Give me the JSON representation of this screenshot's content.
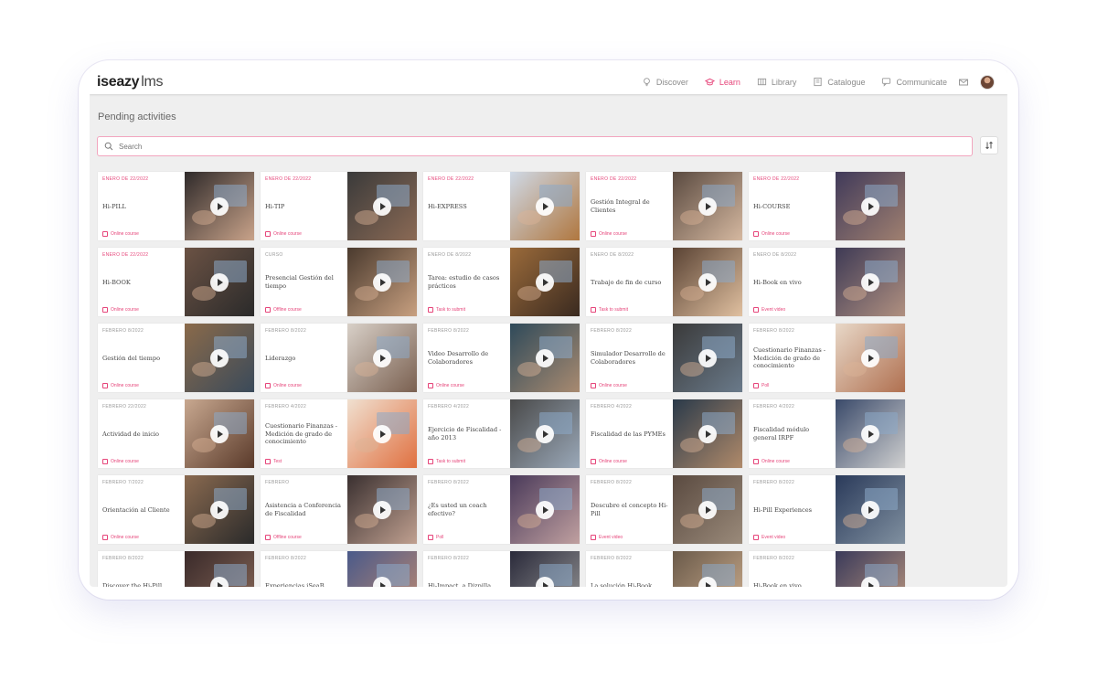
{
  "app": {
    "logo_bold": "iseazy",
    "logo_light": "lms",
    "nav": [
      {
        "label": "Discover",
        "icon": "bulb-icon",
        "active": false
      },
      {
        "label": "Learn",
        "icon": "learn-icon",
        "active": true
      },
      {
        "label": "Library",
        "icon": "library-icon",
        "active": false
      },
      {
        "label": "Catalogue",
        "icon": "catalogue-icon",
        "active": false
      },
      {
        "label": "Communicate",
        "icon": "chat-icon",
        "active": false
      }
    ],
    "accent_color": "#e6457a"
  },
  "page": {
    "title": "Pending activities",
    "search_placeholder": "Search"
  },
  "cards": [
    {
      "date": "ENERO DE 22/2022",
      "title": "Hi-PILL",
      "type": "Online course",
      "date_muted": false
    },
    {
      "date": "ENERO DE 22/2022",
      "title": "Hi-TIP",
      "type": "Online course",
      "date_muted": false
    },
    {
      "date": "ENERO DE 22/2022",
      "title": "Hi-EXPRESS",
      "type": "",
      "date_muted": false
    },
    {
      "date": "ENERO DE 22/2022",
      "title": "Gestión Integral de Clientes",
      "type": "Online course",
      "date_muted": false
    },
    {
      "date": "ENERO DE 22/2022",
      "title": "Hi-COURSE",
      "type": "Online course",
      "date_muted": false
    },
    {
      "date": "ENERO DE 22/2022",
      "title": "Hi-BOOK",
      "type": "Online course",
      "date_muted": false
    },
    {
      "date": "CURSO",
      "title": "Presencial Gestión del tiempo",
      "type": "Offline course",
      "date_muted": true
    },
    {
      "date": "ENERO DE 8/2022",
      "title": "Tarea: estudio de casos prácticos",
      "type": "Task to submit",
      "date_muted": true
    },
    {
      "date": "ENERO DE 8/2022",
      "title": "Trabajo de fin de curso",
      "type": "Task to submit",
      "date_muted": true
    },
    {
      "date": "ENERO DE 8/2022",
      "title": "Hi-Book en vivo",
      "type": "Event video",
      "date_muted": true
    },
    {
      "date": "FEBRERO 8/2022",
      "title": "Gestión del tiempo",
      "type": "Online course",
      "date_muted": true
    },
    {
      "date": "FEBRERO 8/2022",
      "title": "Liderazgo",
      "type": "Online course",
      "date_muted": true
    },
    {
      "date": "FEBRERO 8/2022",
      "title": "Video Desarrollo de Colaboradores",
      "type": "Online course",
      "date_muted": true
    },
    {
      "date": "FEBRERO 8/2022",
      "title": "Simulador Desarrollo de Colaboradores",
      "type": "Online course",
      "date_muted": true
    },
    {
      "date": "FEBRERO 8/2022",
      "title": "Cuestionario Finanzas - Medición de grado de conocimiento",
      "type": "Poll",
      "date_muted": true
    },
    {
      "date": "FEBRERO 22/2022",
      "title": "Actividad de inicio",
      "type": "Online course",
      "date_muted": true
    },
    {
      "date": "FEBRERO 4/2022",
      "title": "Cuestionario Finanzas - Medición de grado de conocimiento",
      "type": "Test",
      "date_muted": true
    },
    {
      "date": "FEBRERO 4/2022",
      "title": "Ejercicio de Fiscalidad - año 2013",
      "type": "Task to submit",
      "date_muted": true
    },
    {
      "date": "FEBRERO 4/2022",
      "title": "Fiscalidad de las PYMEs",
      "type": "Online course",
      "date_muted": true
    },
    {
      "date": "FEBRERO 4/2022",
      "title": "Fiscalidad módulo general IRPF",
      "type": "Online course",
      "date_muted": true
    },
    {
      "date": "FEBRERO 7/2022",
      "title": "Orientación al Cliente",
      "type": "Online course",
      "date_muted": true
    },
    {
      "date": "FEBRERO",
      "title": "Asistencia a Conferencia de Fiscalidad",
      "type": "Offline course",
      "date_muted": true
    },
    {
      "date": "FEBRERO 8/2022",
      "title": "¿Es usted un coach efectivo?",
      "type": "Poll",
      "date_muted": true
    },
    {
      "date": "FEBRERO 8/2022",
      "title": "Descubre el concepto Hi-Pill",
      "type": "Event video",
      "date_muted": true
    },
    {
      "date": "FEBRERO 8/2022",
      "title": "Hi-Pill Experiences",
      "type": "Event video",
      "date_muted": true
    },
    {
      "date": "FEBRERO 8/2022",
      "title": "Discover the Hi-Pill",
      "type": "",
      "date_muted": true
    },
    {
      "date": "FEBRERO 8/2022",
      "title": "Experiencias iSeaB",
      "type": "",
      "date_muted": true
    },
    {
      "date": "FEBRERO 8/2022",
      "title": "Hi-Impact, a Dizpilla",
      "type": "",
      "date_muted": true
    },
    {
      "date": "FEBRERO 8/2022",
      "title": "La solución Hi-Book",
      "type": "",
      "date_muted": true
    },
    {
      "date": "FEBRERO 8/2022",
      "title": "Hi-Book en vivo",
      "type": "",
      "date_muted": true
    }
  ]
}
